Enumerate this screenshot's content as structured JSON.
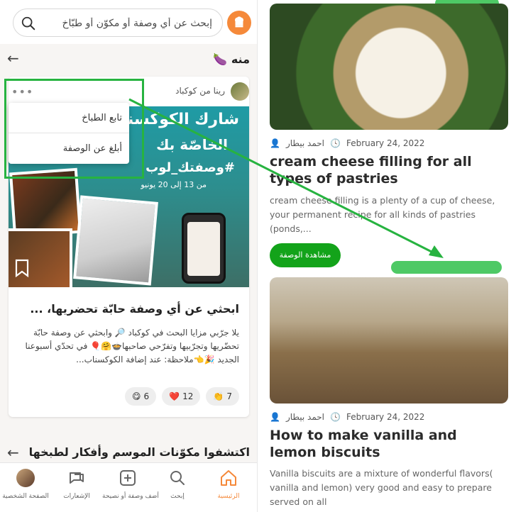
{
  "left_app": {
    "search": {
      "placeholder": "إبحث عن أي وصفة أو مكوّن أو طبّاخ"
    },
    "section": {
      "title": "منه 🍆"
    },
    "card": {
      "author": "رينا من كوكباد",
      "menu_icon": "more-dots-icon",
      "image": {
        "line1": "شارك الكوكسناب",
        "line2": "الخاصّة بك",
        "hashtag": "#وصفتك_لوب",
        "dates": "من 13 إلى 20 يونيو"
      },
      "title": "ابحثي عن أي وصفة حابّة تحضريها، ...",
      "description": "يلا جرّبي مزايا البحث في كوكباد 🔎 وابحثي عن وصفة حابّة تحضّريها وتجرّبيها وتفرّحي صاحبها🍲🤗🎈 في تحدّي أسبوعنا الجديد 🎉👈ملاحظة: عند إضافة الكوكسناب...",
      "reactions": [
        {
          "emoji": "😋",
          "count": "6"
        },
        {
          "emoji": "❤️",
          "count": "12"
        },
        {
          "emoji": "👏",
          "count": "7"
        }
      ]
    },
    "popup_menu": {
      "follow": "تابع الطباخ",
      "report": "أبلغ عن الوصفة"
    },
    "bottom_section": {
      "title": "اكتشفوا مكوّنات الموسم وأفكار لطبخها"
    },
    "bottom_nav": [
      {
        "label": "الرئيسية",
        "icon": "home-icon",
        "active": true
      },
      {
        "label": "إبحث",
        "icon": "search-icon",
        "active": false
      },
      {
        "label": "أضف وصفة أو نصيحة",
        "icon": "add-icon",
        "active": false
      },
      {
        "label": "الإشعارات",
        "icon": "notifications-icon",
        "active": false
      },
      {
        "label": "الصفحة الشخصية",
        "icon": "profile-avatar",
        "active": false
      }
    ]
  },
  "right_blog": {
    "posts": [
      {
        "author": "احمد بيطار",
        "date": "February 24, 2022",
        "title": "cream cheese filling for all types of pastries",
        "excerpt": "cream cheese filling is a plenty of a cup of cheese, your permanent recipe for all kinds of pastries (ponds,...",
        "button": "مشاهدة الوصفة"
      },
      {
        "author": "احمد بيطار",
        "date": "February 24, 2022",
        "title": "How to make vanilla and lemon biscuits",
        "excerpt": "Vanilla biscuits are a mixture of wonderful flavors( vanilla and lemon) very good and easy to prepare served on all"
      }
    ]
  },
  "colors": {
    "brand_orange": "#f5893a",
    "annotation_green": "#27b340",
    "button_green": "#13a31a"
  }
}
